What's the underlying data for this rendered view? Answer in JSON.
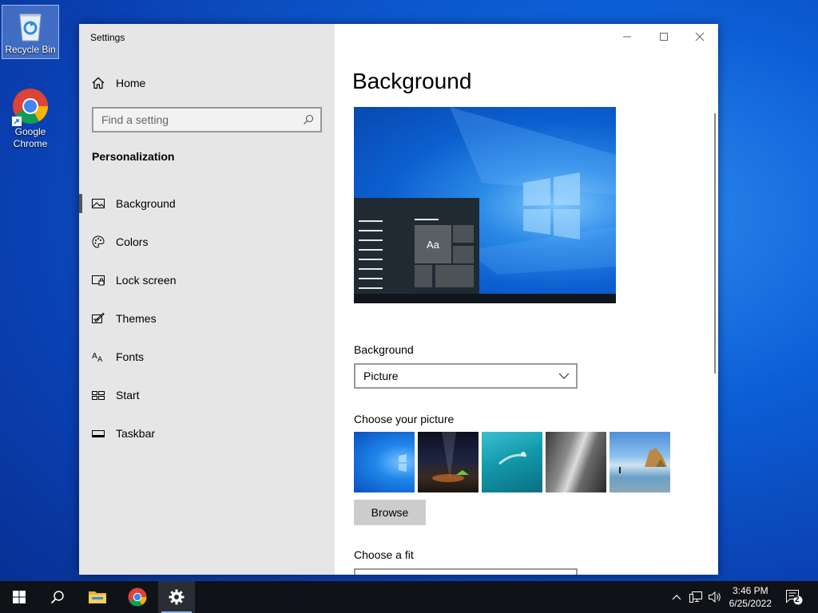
{
  "desktop": {
    "icons": [
      {
        "label": "Recycle Bin",
        "icon": "recycle-bin-icon"
      },
      {
        "label": "Google Chrome",
        "icon": "chrome-icon"
      }
    ]
  },
  "window": {
    "title": "Settings",
    "controls": {
      "minimize": "minimize-icon",
      "maximize": "maximize-icon",
      "close": "close-icon"
    }
  },
  "sidebar": {
    "home_label": "Home",
    "search_placeholder": "Find a setting",
    "section_title": "Personalization",
    "items": [
      {
        "label": "Background",
        "icon": "picture-icon",
        "active": true
      },
      {
        "label": "Colors",
        "icon": "palette-icon",
        "active": false
      },
      {
        "label": "Lock screen",
        "icon": "lock-screen-icon",
        "active": false
      },
      {
        "label": "Themes",
        "icon": "themes-icon",
        "active": false
      },
      {
        "label": "Fonts",
        "icon": "fonts-icon",
        "active": false
      },
      {
        "label": "Start",
        "icon": "start-icon",
        "active": false
      },
      {
        "label": "Taskbar",
        "icon": "taskbar-icon",
        "active": false
      }
    ]
  },
  "main": {
    "title": "Background",
    "preview_sample_text": "Aa",
    "background_label": "Background",
    "background_value": "Picture",
    "choose_picture_label": "Choose your picture",
    "pictures": [
      "windows-blue",
      "night-sky-tent",
      "underwater-swimmer",
      "rock-cliff",
      "beach-rocks"
    ],
    "browse_label": "Browse",
    "choose_fit_label": "Choose a fit"
  },
  "taskbar": {
    "buttons": [
      "start-icon",
      "search-icon",
      "file-explorer-icon",
      "chrome-icon",
      "settings-icon"
    ],
    "tray": {
      "time": "3:46 PM",
      "date": "6/25/2022",
      "notification_count": "2"
    }
  },
  "colors": {
    "accent": "#0078d7",
    "sidebar_bg": "#e6e6e6",
    "taskbar_bg": "#0f1216"
  }
}
